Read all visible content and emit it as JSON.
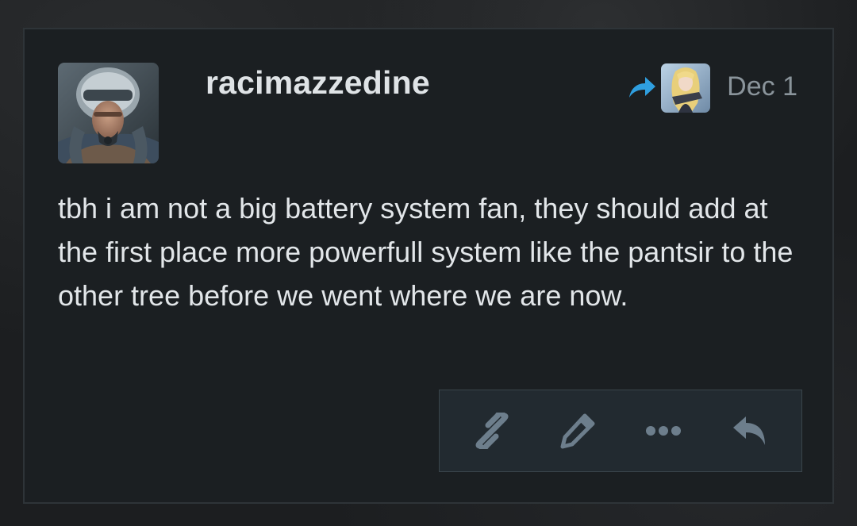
{
  "post": {
    "username": "racimazzedine",
    "date": "Dec 1",
    "body": "tbh i am not a big battery system fan, they should add at the first place more powerfull system like the pantsir to the other tree before we went where we are now."
  },
  "icons": {
    "reply_to": "share-arrow-icon",
    "copy_link": "link-icon",
    "edit": "pencil-icon",
    "more": "ellipsis-icon",
    "reply": "reply-icon"
  },
  "colors": {
    "card_background": "#1b1f22",
    "username": "#dfe3e6",
    "body_text": "#e2e6e9",
    "date_text": "#8a949b",
    "accent_blue": "#2f9fe0",
    "action_icon": "#6d7e8c"
  }
}
